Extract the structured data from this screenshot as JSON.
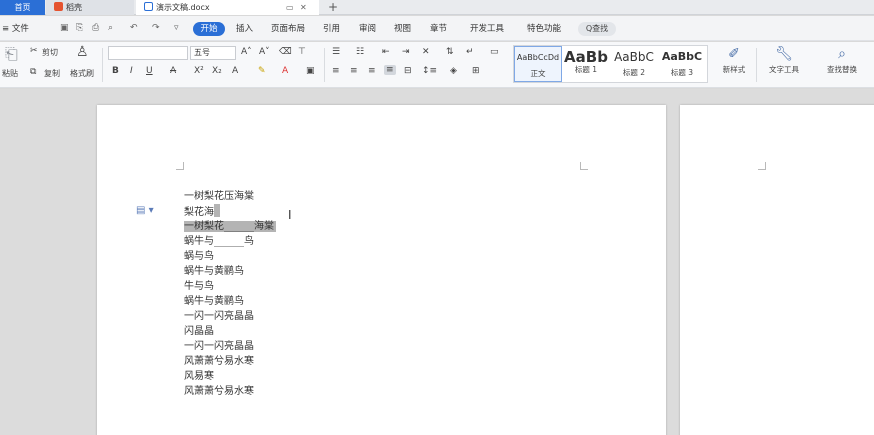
{
  "tabs": {
    "home": "首页",
    "daoke": "稻壳",
    "document": "演示文稿.docx",
    "plus": "+"
  },
  "menu": {
    "file": "≡ 文件",
    "items": [
      "开始",
      "插入",
      "页面布局",
      "引用",
      "审阅",
      "视图",
      "章节",
      "开发工具",
      "特色功能"
    ],
    "search": "Q查找"
  },
  "ribbon": {
    "paste": "粘贴",
    "cut": "剪切",
    "copy": "复制",
    "format_painter": "格式刷",
    "font_size": "五号",
    "styles": [
      {
        "sample": "AaBbCcDd",
        "name": "正文"
      },
      {
        "sample": "AaBb",
        "name": "标题 1"
      },
      {
        "sample": "AaBbC",
        "name": "标题 2"
      },
      {
        "sample": "AaBbC",
        "name": "标题 3"
      }
    ],
    "new_style": "新样式",
    "text_tools": "文字工具",
    "find_replace": "查找替换"
  },
  "document": {
    "lines": [
      "一树梨花压海棠",
      "梨花海",
      "一树梨花______海棠",
      "蜗牛与______鸟",
      "蜗与鸟",
      "蜗牛与黄鹂鸟",
      "牛与鸟",
      "蜗牛与黄鹂鸟",
      "一闪一闪亮晶晶",
      "闪晶晶",
      "一闪一闪亮晶晶",
      "风萧萧兮易水寒",
      "风易寒",
      "风萧萧兮易水寒"
    ]
  },
  "colors": {
    "accent": "#2b6fd6",
    "selection": "#b4b4b4"
  }
}
